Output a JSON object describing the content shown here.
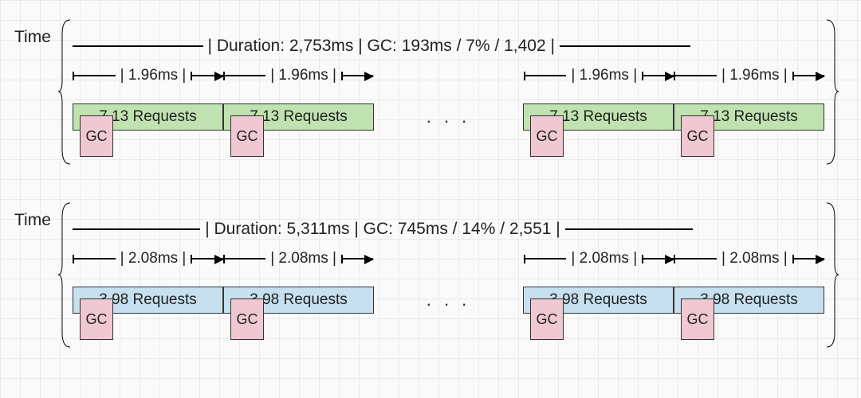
{
  "chart_data": [
    {
      "type": "timeline",
      "label": "Time",
      "summary": "| Duration: 2,753ms | GC: 193ms / 7% / 1,402 |",
      "duration_ms": 2753,
      "gc_ms": 193,
      "gc_pct": 7,
      "gc_count": 1402,
      "interval_ms": 1.96,
      "requests_per_interval": 7.13,
      "interval_label": "| 1.96ms |",
      "request_label": "7.13 Requests",
      "gc_label": "GC",
      "ellipsis": ". . .",
      "fill": "#c0e2b0"
    },
    {
      "type": "timeline",
      "label": "Time",
      "summary": "| Duration: 5,311ms | GC: 745ms / 14% / 2,551 |",
      "duration_ms": 5311,
      "gc_ms": 745,
      "gc_pct": 14,
      "gc_count": 2551,
      "interval_ms": 2.08,
      "requests_per_interval": 3.98,
      "interval_label": "| 2.08ms |",
      "request_label": "3.98 Requests",
      "gc_label": "GC",
      "ellipsis": ". . .",
      "fill": "#c6e0ef"
    }
  ]
}
